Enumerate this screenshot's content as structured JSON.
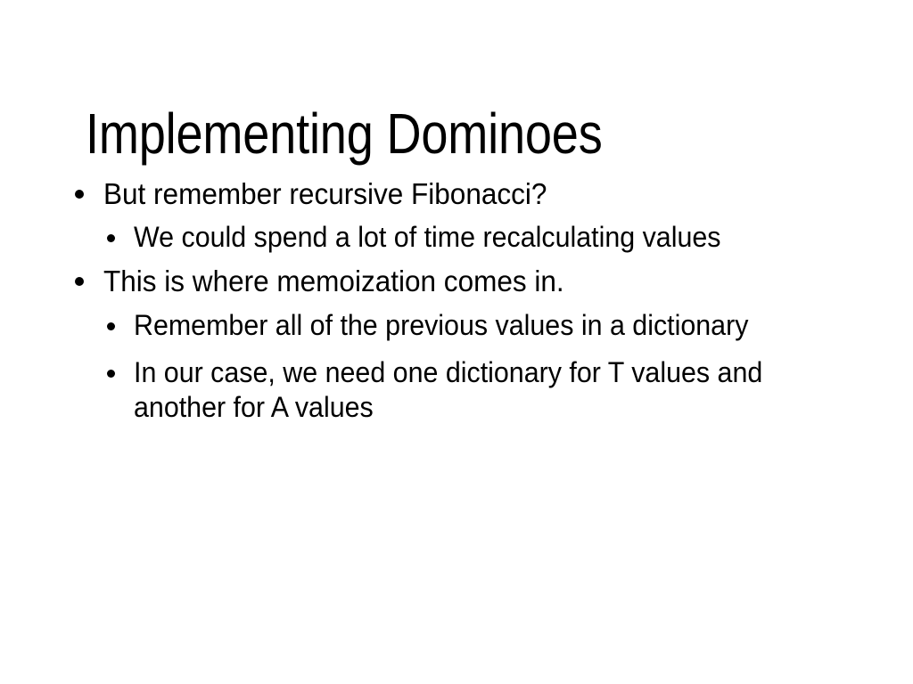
{
  "slide": {
    "background_color": "#ffffff",
    "text_color": "#000000",
    "title": "Implementing Dominoes",
    "bullets": [
      {
        "level": 1,
        "text": "But remember recursive Fibonacci?"
      },
      {
        "level": 2,
        "text": "We could spend a lot of time recalculating values"
      },
      {
        "level": 1,
        "text": "This is where memoization comes in."
      },
      {
        "level": 2,
        "text": "Remember all of the previous values in a dictionary"
      },
      {
        "level": 2,
        "text": "In our case, we need one dictionary for T values and another for A values"
      }
    ]
  }
}
